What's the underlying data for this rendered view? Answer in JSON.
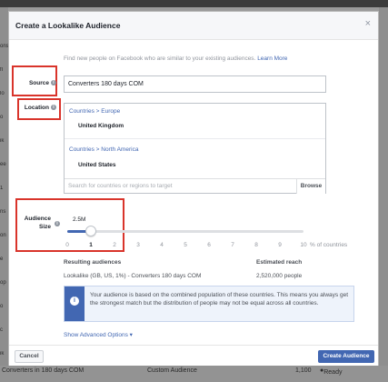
{
  "background": {
    "left_fragments": [
      "ons",
      "fl",
      "lo",
      "o",
      "ik",
      "ee",
      "1",
      "ns",
      "on",
      "e",
      "op",
      "o",
      "c",
      "ik"
    ],
    "bottom": {
      "left_text": "Converters in 180 days COM",
      "mid_text": "Custom Audience",
      "count": "1,100",
      "status": "Ready"
    }
  },
  "dialog": {
    "title": "Create a Lookalike Audience",
    "close_glyph": "×",
    "intro_text": "Find new people on Facebook who are similar to your existing audiences.",
    "learn_more": "Learn More",
    "source": {
      "label": "Source",
      "value": "Converters 180 days COM"
    },
    "location": {
      "label": "Location",
      "groups": [
        {
          "region_path": [
            "Countries",
            "Europe"
          ],
          "country": "United Kingdom"
        },
        {
          "region_path": [
            "Countries",
            "North America"
          ],
          "country": "United States"
        }
      ],
      "path_separator": ">",
      "search_placeholder": "Search for countries or regions to target",
      "browse_label": "Browse"
    },
    "audience_size": {
      "label_line1": "Audience",
      "label_line2": "Size",
      "estimate": "2.5M",
      "selected_percent": 1,
      "ticks": [
        "0",
        "1",
        "2",
        "3",
        "4",
        "5",
        "6",
        "7",
        "8",
        "9",
        "10"
      ],
      "unit_label": "% of countries"
    },
    "results": {
      "audiences_header": "Resulting audiences",
      "audience_value": "Lookalike (GB, US, 1%) - Converters 180 days COM",
      "reach_header": "Estimated reach",
      "reach_value": "2,520,000 people"
    },
    "notice": {
      "icon_glyph": "i",
      "text": "Your audience is based on the combined population of these countries. This means you always get the strongest match but the distribution of people may not be equal across all countries."
    },
    "advanced_options": "Show Advanced Options ▾",
    "cancel_label": "Cancel",
    "create_label": "Create Audience"
  },
  "colors": {
    "accent": "#4267b2",
    "highlight_box": "#d9342b"
  }
}
